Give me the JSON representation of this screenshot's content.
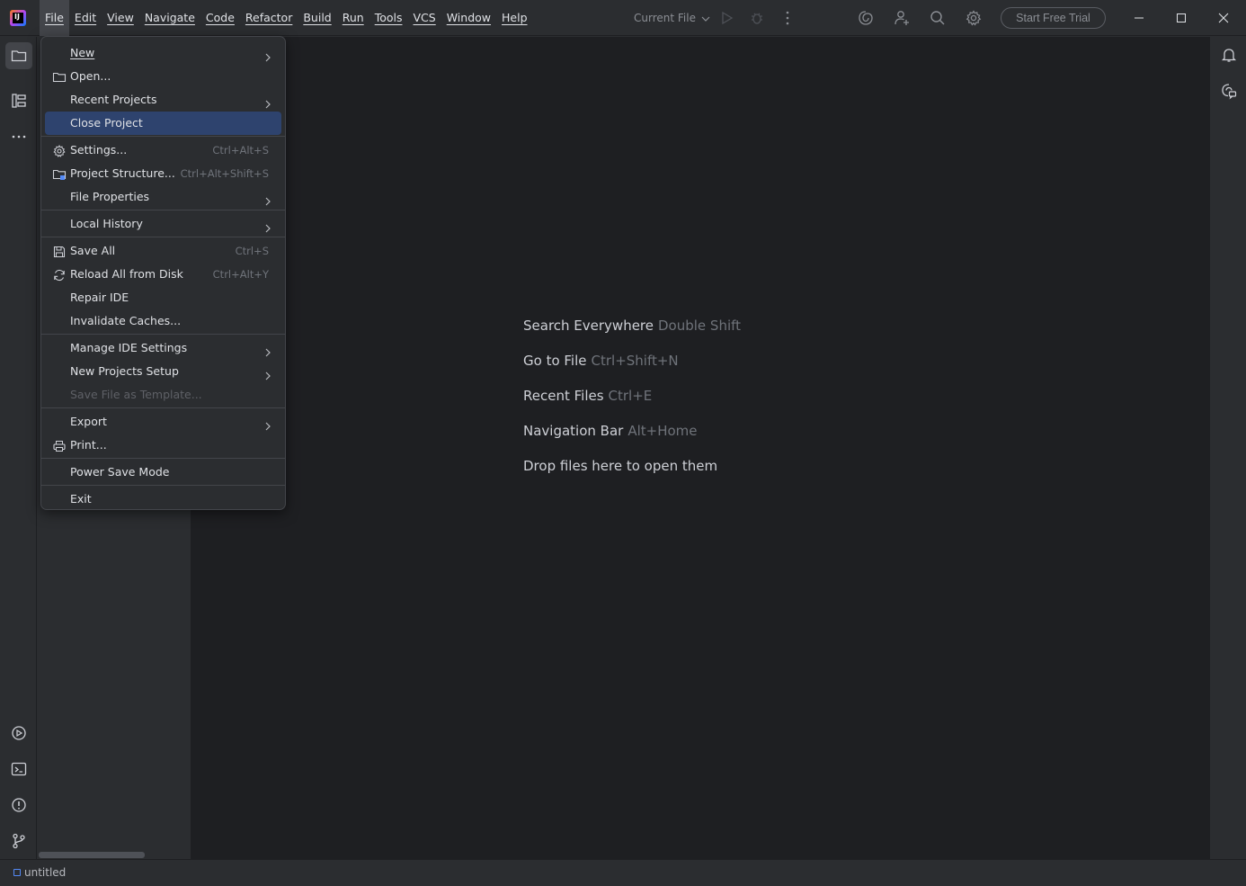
{
  "menubar": {
    "items": [
      {
        "label": "File",
        "active": true
      },
      {
        "label": "Edit"
      },
      {
        "label": "View"
      },
      {
        "label": "Navigate"
      },
      {
        "label": "Code"
      },
      {
        "label": "Refactor"
      },
      {
        "label": "Build"
      },
      {
        "label": "Run"
      },
      {
        "label": "Tools"
      },
      {
        "label": "VCS"
      },
      {
        "label": "Window"
      },
      {
        "label": "Help"
      }
    ]
  },
  "toolbar": {
    "run_config": "Current File",
    "trial_button": "Start Free Trial"
  },
  "file_menu": {
    "new": "New",
    "open": "Open...",
    "recent_projects": "Recent Projects",
    "close_project": "Close Project",
    "settings": "Settings...",
    "settings_shortcut": "Ctrl+Alt+S",
    "project_structure": "Project Structure...",
    "project_structure_shortcut": "Ctrl+Alt+Shift+S",
    "file_properties": "File Properties",
    "local_history": "Local History",
    "save_all": "Save All",
    "save_all_shortcut": "Ctrl+S",
    "reload_all": "Reload All from Disk",
    "reload_all_shortcut": "Ctrl+Alt+Y",
    "repair_ide": "Repair IDE",
    "invalidate_caches": "Invalidate Caches...",
    "manage_ide_settings": "Manage IDE Settings",
    "new_projects_setup": "New Projects Setup",
    "save_file_as_template": "Save File as Template...",
    "export": "Export",
    "print": "Print...",
    "power_save_mode": "Power Save Mode",
    "exit": "Exit"
  },
  "editor_hints": [
    {
      "action": "Search Everywhere",
      "key": "Double Shift"
    },
    {
      "action": "Go to File",
      "key": "Ctrl+Shift+N"
    },
    {
      "action": "Recent Files",
      "key": "Ctrl+E"
    },
    {
      "action": "Navigation Bar",
      "key": "Alt+Home"
    },
    {
      "action": "Drop files here to open them",
      "key": ""
    }
  ],
  "statusbar": {
    "project_name": "untitled"
  },
  "colors": {
    "background": "#2b2d30",
    "editor": "#1e1f22",
    "selection": "#2e436e",
    "accent": "#548af7"
  }
}
